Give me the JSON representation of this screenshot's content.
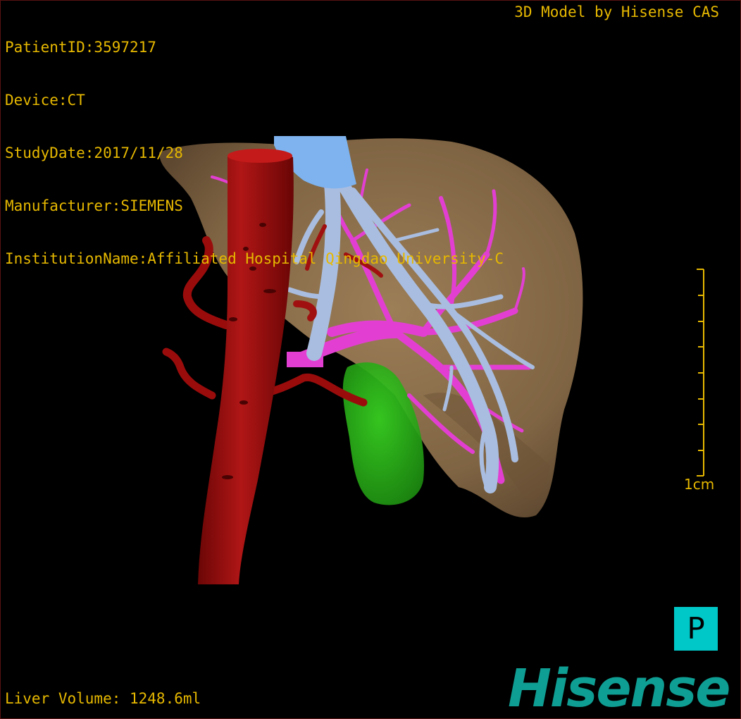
{
  "patient": {
    "id_line": "PatientID:3597217",
    "device_line": "Device:CT",
    "date_line": "StudyDate:2017/11/28",
    "manufacturer_line": "Manufacturer:SIEMENS",
    "institution_line": "InstitutionName:Affiliated Hospital Qingdao University-C"
  },
  "credit": "3D Model by Hisense CAS",
  "volume": "Liver Volume: 1248.6ml",
  "scale": {
    "label": "1cm"
  },
  "orientation": "P",
  "logo": "Hisense",
  "colors": {
    "overlay_text": "#e6b800",
    "liver": "#8a6d48",
    "aorta": "#9a0c0c",
    "portal_vein": "#e23fd2",
    "hepatic_vein": "#a9bde0",
    "ivc": "#7eb3ef",
    "gallbladder": "#2fb81b",
    "orientation_box": "#00c8c8",
    "logo": "#0f9e93"
  }
}
